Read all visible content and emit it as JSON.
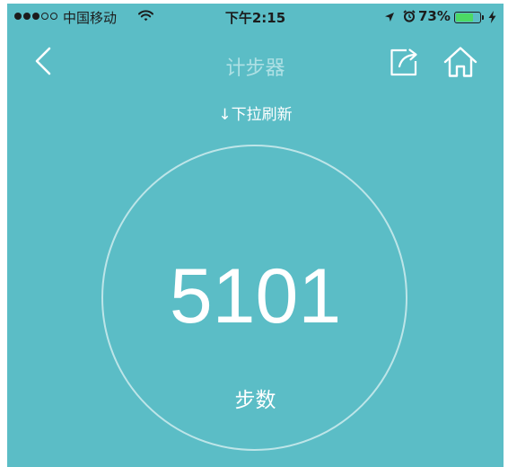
{
  "status_bar": {
    "carrier": "中国移动",
    "time": "下午2:15",
    "battery_percent": "73%",
    "battery_level": 0.73,
    "signal_bars_filled": 3,
    "signal_bars_total": 5,
    "icons": [
      "wifi-icon",
      "location-arrow-icon",
      "alarm-clock-icon",
      "battery-icon",
      "charging-bolt-icon"
    ]
  },
  "nav": {
    "title": "计步器",
    "back_icon": "chevron-left-icon",
    "share_icon": "share-icon",
    "home_icon": "home-icon"
  },
  "content": {
    "pull_hint": "↓下拉刷新",
    "step_count": "5101",
    "step_label": "步数"
  },
  "colors": {
    "background": "#5bbdc6",
    "title": "#aee0e4",
    "text": "#ffffff",
    "battery_fill": "#4cd964"
  }
}
